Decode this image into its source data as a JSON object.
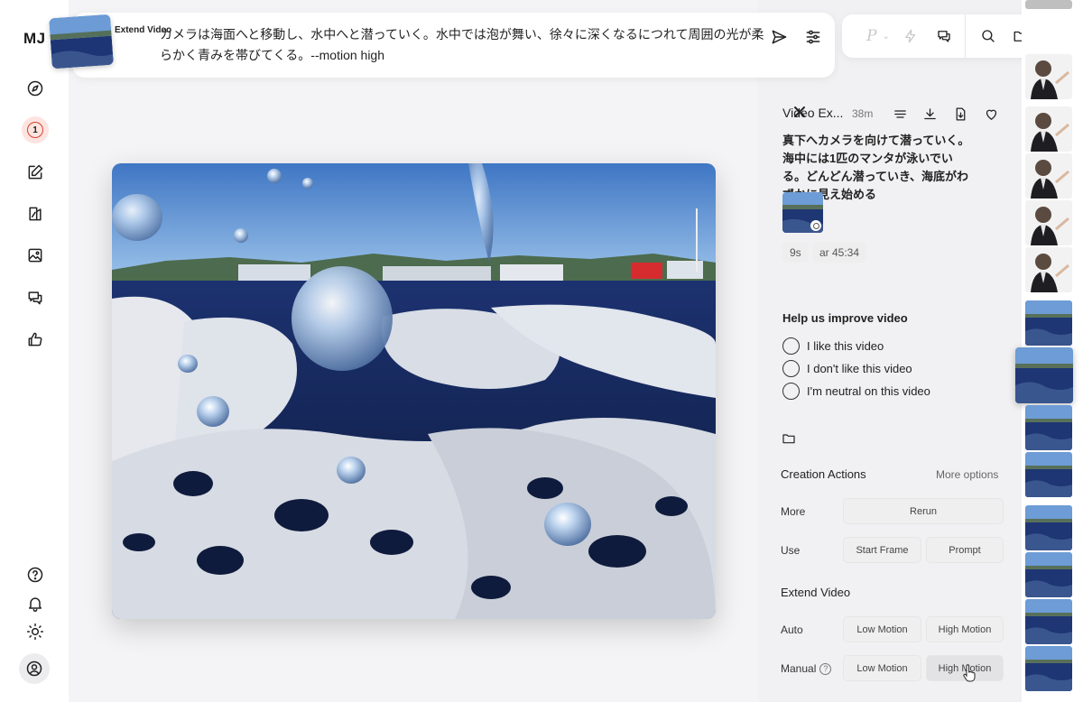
{
  "sidebar": {
    "logo": "MJ",
    "notification_count": "1",
    "items": [
      {
        "name": "explore",
        "icon": "compass-icon"
      },
      {
        "name": "create",
        "icon": "pencil-square-icon"
      },
      {
        "name": "edit",
        "icon": "edit-icon"
      },
      {
        "name": "organize",
        "icon": "image-icon"
      },
      {
        "name": "chat",
        "icon": "chat-icon"
      },
      {
        "name": "rate",
        "icon": "thumbs-up-icon"
      }
    ],
    "bottom": [
      "help-icon",
      "bell-icon",
      "sun-icon",
      "user-icon"
    ]
  },
  "prompt_bar": {
    "attachment_label": "Extend Video",
    "prompt_text": "カメラは海面へと移動し、水中へと潜っていく。水中では泡が舞い、徐々に深くなるにつれて周囲の光が柔らかく青みを帯びてくる。--motion high"
  },
  "toolbar": {
    "mode_letter": "P",
    "icons": [
      "lightning-icon",
      "chat-icon",
      "search-icon",
      "folder-icon"
    ]
  },
  "details": {
    "title": "Video Ex...",
    "age": "38m",
    "prompt": "真下へカメラを向けて潜っていく。海中には1匹のマンタが泳いでいる。どんどん潜っていき、海底がわずかに見え始める",
    "chips": [
      "9s",
      "ar 45:34"
    ],
    "feedback": {
      "heading": "Help us improve video",
      "options": [
        "I like this video",
        "I don't like this video",
        "I'm neutral on this video"
      ]
    },
    "creation_actions": {
      "heading": "Creation Actions",
      "more_options": "More options",
      "more_label": "More",
      "rerun": "Rerun",
      "use_label": "Use",
      "start_frame": "Start Frame",
      "prompt": "Prompt"
    },
    "extend_video": {
      "heading": "Extend Video",
      "auto_label": "Auto",
      "manual_label": "Manual",
      "low_motion": "Low Motion",
      "high_motion": "High Motion"
    }
  },
  "colors": {
    "accent_notification": "#d9442f",
    "sky": "#5b93d4",
    "sea": "#16285a",
    "foam": "#e6e8ee"
  }
}
